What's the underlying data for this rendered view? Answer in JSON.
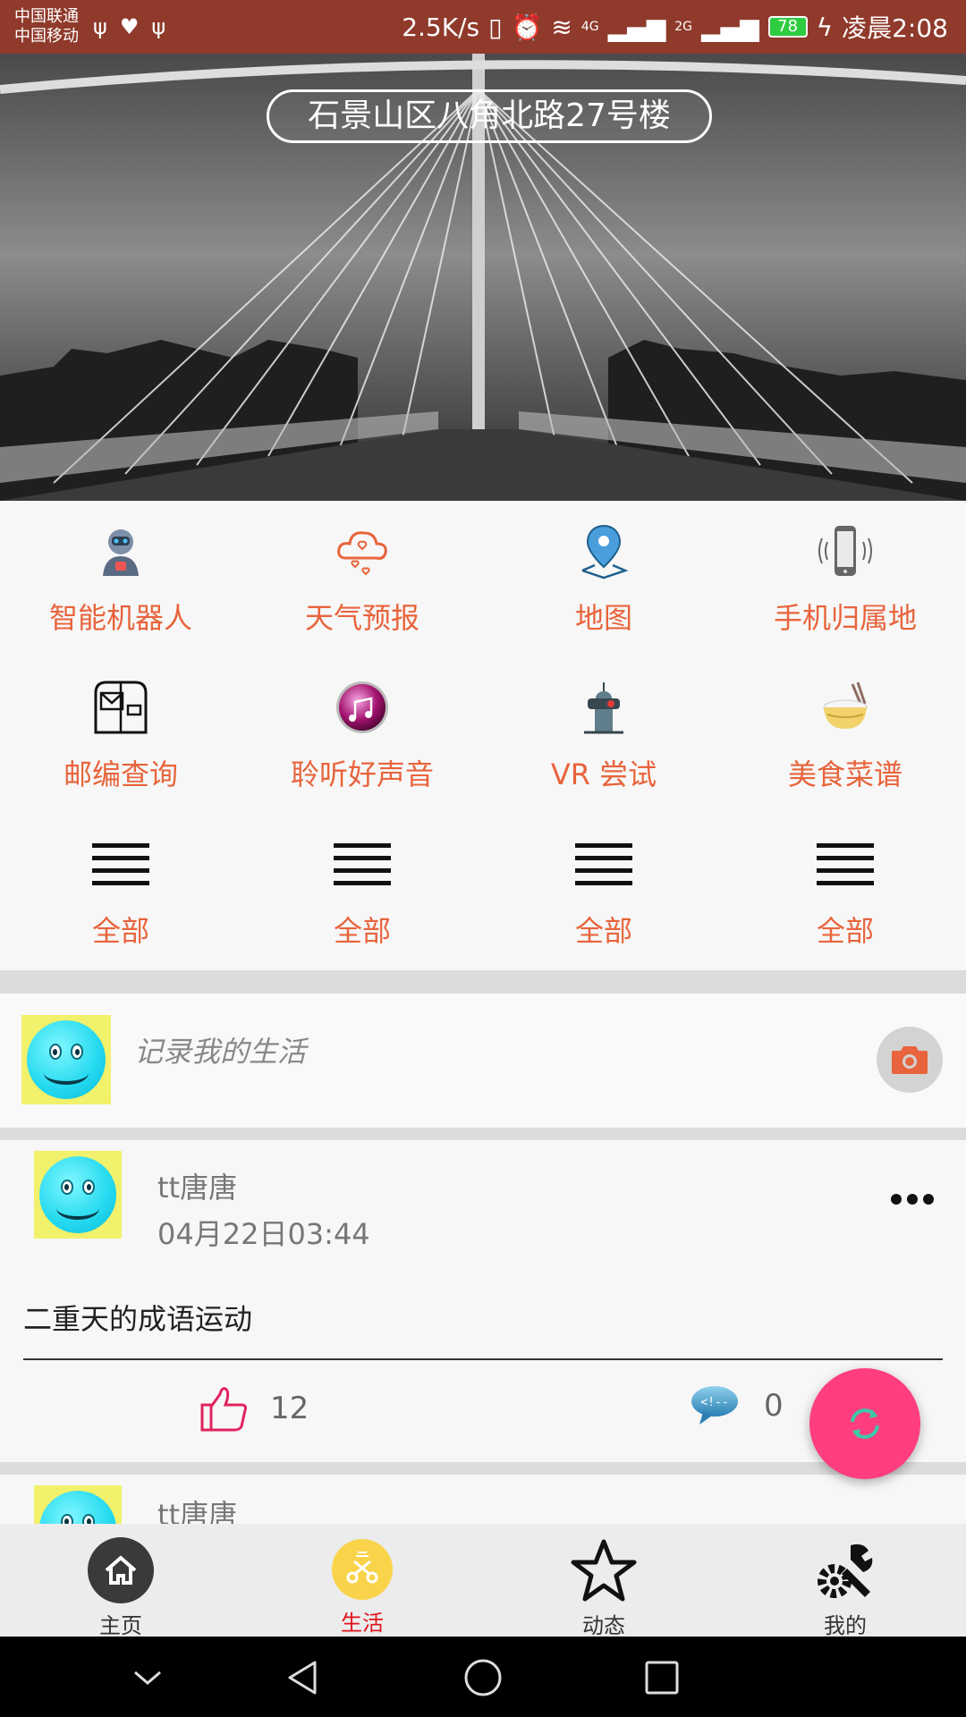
{
  "status_bar": {
    "carrier1": "中国联通",
    "carrier2": "中国移动",
    "speed": "2.5K/s",
    "net1": "4G",
    "net2": "2G",
    "battery": "78",
    "time": "凌晨2:08"
  },
  "hero": {
    "location": "石景山区八角北路27号楼"
  },
  "grid": {
    "items": [
      {
        "label": "智能机器人",
        "icon": "robot-icon"
      },
      {
        "label": "天气预报",
        "icon": "weather-cloud-icon"
      },
      {
        "label": "地图",
        "icon": "map-pin-icon"
      },
      {
        "label": "手机归属地",
        "icon": "phone-icon"
      },
      {
        "label": "邮编查询",
        "icon": "mailbox-icon"
      },
      {
        "label": "聆听好声音",
        "icon": "music-icon"
      },
      {
        "label": "VR 尝试",
        "icon": "vr-icon"
      },
      {
        "label": "美食菜谱",
        "icon": "food-bowl-icon"
      },
      {
        "label": "全部",
        "icon": "menu-icon"
      },
      {
        "label": "全部",
        "icon": "menu-icon"
      },
      {
        "label": "全部",
        "icon": "menu-icon"
      },
      {
        "label": "全部",
        "icon": "menu-icon"
      }
    ]
  },
  "composer": {
    "placeholder": "记录我的生活"
  },
  "feed": [
    {
      "username": "tt唐唐",
      "time": "04月22日03:44",
      "content": "二重天的成语运动",
      "likes": "12",
      "comments": "0"
    },
    {
      "username": "tt唐唐"
    }
  ],
  "bottom_nav": {
    "items": [
      {
        "label": "主页"
      },
      {
        "label": "生活"
      },
      {
        "label": "动态"
      },
      {
        "label": "我的"
      }
    ],
    "active_index": 1
  },
  "colors": {
    "status_bar": "#8f3a2b",
    "accent": "#e8643c",
    "fab": "#ff3d7f",
    "active_nav": "#e0121b"
  }
}
